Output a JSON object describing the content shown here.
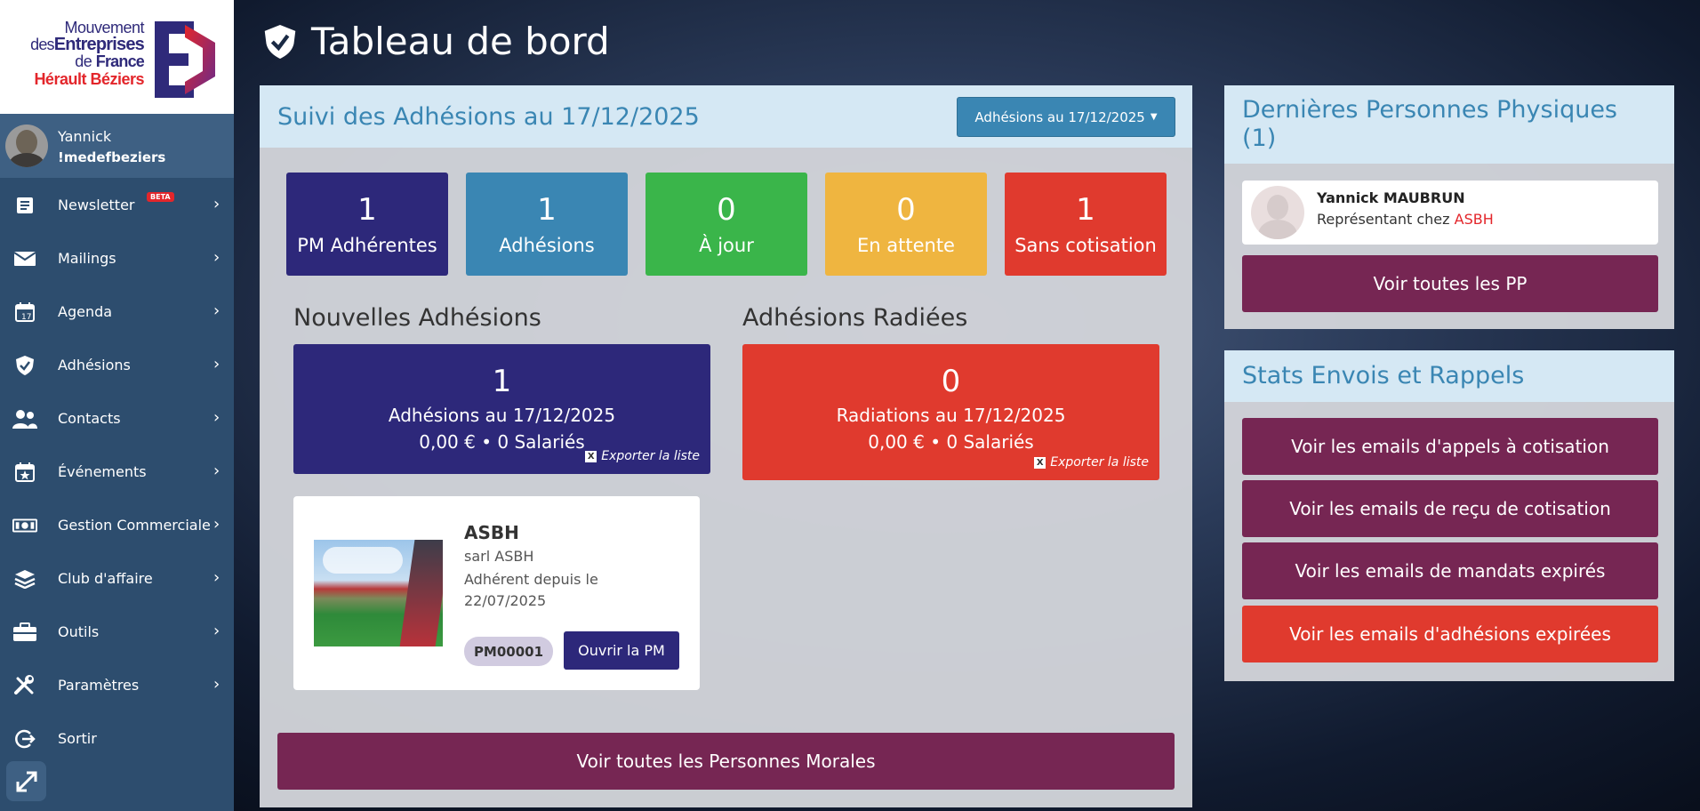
{
  "logo": {
    "line1": "Mouvement",
    "line2_prefix": "des",
    "line2_bold": "Entreprises",
    "line3_prefix": "de",
    "line3_bold": "France",
    "line4": "Hérault Béziers"
  },
  "user": {
    "name": "Yannick",
    "login": "!medefbeziers"
  },
  "sidebar": {
    "items": [
      {
        "label": "Newsletter",
        "icon": "newspaper-icon",
        "badge": "BETA"
      },
      {
        "label": "Mailings",
        "icon": "envelope-icon"
      },
      {
        "label": "Agenda",
        "icon": "calendar-icon"
      },
      {
        "label": "Adhésions",
        "icon": "shield-check-icon"
      },
      {
        "label": "Contacts",
        "icon": "users-icon"
      },
      {
        "label": "Événements",
        "icon": "calendar-star-icon"
      },
      {
        "label": "Gestion Commerciale",
        "icon": "money-bill-icon"
      },
      {
        "label": "Club d'affaire",
        "icon": "layers-icon"
      },
      {
        "label": "Outils",
        "icon": "briefcase-icon"
      },
      {
        "label": "Paramètres",
        "icon": "tools-icon"
      },
      {
        "label": "Sortir",
        "icon": "sign-out-icon"
      }
    ],
    "chevron": "›"
  },
  "header": {
    "title": "Tableau de bord",
    "icon": "shield-check-icon"
  },
  "main": {
    "title": "Suivi des Adhésions au 17/12/2025",
    "dropdown_label": "Adhésions au 17/12/2025",
    "stats": [
      {
        "value": "1",
        "label": "PM Adhérentes",
        "color": "#2d287a"
      },
      {
        "value": "1",
        "label": "Adhésions",
        "color": "#3a86b3"
      },
      {
        "value": "0",
        "label": "À jour",
        "color": "#3ab54a"
      },
      {
        "value": "0",
        "label": "En attente",
        "color": "#efb540"
      },
      {
        "value": "1",
        "label": "Sans cotisation",
        "color": "#e03a2e"
      }
    ],
    "new": {
      "title": "Nouvelles Adhésions",
      "count": "1",
      "subtitle": "Adhésions au 17/12/2025",
      "meta": "0,00 € • 0 Salariés",
      "export": "Exporter la liste"
    },
    "removed": {
      "title": "Adhésions Radiées",
      "count": "0",
      "subtitle": "Radiations au 17/12/2025",
      "meta": "0,00 € • 0 Salariés",
      "export": "Exporter la liste"
    },
    "company": {
      "name": "ASBH",
      "legal": "sarl ASBH",
      "since": "Adhérent depuis le 22/07/2025",
      "code": "PM00001",
      "open_label": "Ouvrir la PM"
    },
    "all_pm_label": "Voir toutes les Personnes Morales"
  },
  "persons": {
    "title": "Dernières Personnes Physiques (1)",
    "person": {
      "name": "Yannick MAUBRUN",
      "role_prefix": "Représentant chez",
      "company": "ASBH"
    },
    "all_label": "Voir toutes les PP"
  },
  "stats_panel": {
    "title": "Stats Envois et Rappels",
    "buttons": [
      {
        "label": "Voir les emails d'appels à cotisation",
        "color": "#762653"
      },
      {
        "label": "Voir les emails de reçu de cotisation",
        "color": "#762653"
      },
      {
        "label": "Voir les emails de mandats expirés",
        "color": "#762653"
      },
      {
        "label": "Voir les emails d'adhésions expirées",
        "color": "#e03a2e"
      }
    ]
  },
  "colors": {
    "sidebar": "#2d4d6e",
    "accent": "#3a86b3",
    "plum": "#762653",
    "red": "#e03a2e",
    "indigo": "#2d287a"
  }
}
